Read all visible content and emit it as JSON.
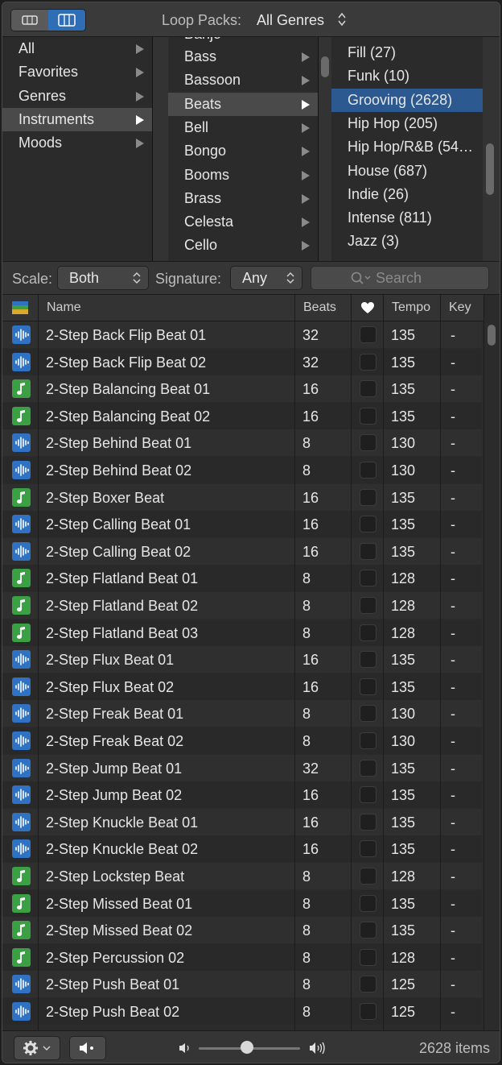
{
  "topbar": {
    "loop_packs_label": "Loop Packs:",
    "loop_packs_value": "All Genres"
  },
  "browser": {
    "column1": [
      {
        "label": "All"
      },
      {
        "label": "Favorites"
      },
      {
        "label": "Genres"
      },
      {
        "label": "Instruments",
        "selected": true
      },
      {
        "label": "Moods"
      }
    ],
    "column2_partial_top": "Banjo",
    "column2": [
      {
        "label": "Bass"
      },
      {
        "label": "Bassoon"
      },
      {
        "label": "Beats",
        "selected": true
      },
      {
        "label": "Bell"
      },
      {
        "label": "Bongo"
      },
      {
        "label": "Booms"
      },
      {
        "label": "Brass"
      },
      {
        "label": "Celesta"
      },
      {
        "label": "Cello"
      }
    ],
    "column3": [
      {
        "label": "Fill (27)"
      },
      {
        "label": "Funk (10)"
      },
      {
        "label": "Grooving (2628)",
        "selected": true
      },
      {
        "label": "Hip Hop (205)"
      },
      {
        "label": "Hip Hop/R&B (54…"
      },
      {
        "label": "House (687)"
      },
      {
        "label": "Indie (26)"
      },
      {
        "label": "Intense (811)"
      },
      {
        "label": "Jazz (3)"
      }
    ]
  },
  "filter": {
    "scale_label": "Scale:",
    "scale_value": "Both",
    "signature_label": "Signature:",
    "signature_value": "Any",
    "search_placeholder": "Search"
  },
  "table": {
    "columns": {
      "name": "Name",
      "beats": "Beats",
      "tempo": "Tempo",
      "key": "Key"
    },
    "rows": [
      {
        "type": "audio",
        "name": "2-Step Back Flip Beat 01",
        "beats": "32",
        "tempo": "135",
        "key": "-"
      },
      {
        "type": "audio",
        "name": "2-Step Back Flip Beat 02",
        "beats": "32",
        "tempo": "135",
        "key": "-"
      },
      {
        "type": "midi",
        "name": "2-Step Balancing Beat 01",
        "beats": "16",
        "tempo": "135",
        "key": "-"
      },
      {
        "type": "midi",
        "name": "2-Step Balancing Beat 02",
        "beats": "16",
        "tempo": "135",
        "key": "-"
      },
      {
        "type": "audio",
        "name": "2-Step Behind Beat 01",
        "beats": "8",
        "tempo": "130",
        "key": "-"
      },
      {
        "type": "audio",
        "name": "2-Step Behind Beat 02",
        "beats": "8",
        "tempo": "130",
        "key": "-"
      },
      {
        "type": "midi",
        "name": "2-Step Boxer Beat",
        "beats": "16",
        "tempo": "135",
        "key": "-"
      },
      {
        "type": "audio",
        "name": "2-Step Calling Beat 01",
        "beats": "16",
        "tempo": "135",
        "key": "-"
      },
      {
        "type": "audio",
        "name": "2-Step Calling Beat 02",
        "beats": "16",
        "tempo": "135",
        "key": "-"
      },
      {
        "type": "midi",
        "name": "2-Step Flatland Beat 01",
        "beats": "8",
        "tempo": "128",
        "key": "-"
      },
      {
        "type": "midi",
        "name": "2-Step Flatland Beat 02",
        "beats": "8",
        "tempo": "128",
        "key": "-"
      },
      {
        "type": "midi",
        "name": "2-Step Flatland Beat 03",
        "beats": "8",
        "tempo": "128",
        "key": "-"
      },
      {
        "type": "audio",
        "name": "2-Step Flux Beat 01",
        "beats": "16",
        "tempo": "135",
        "key": "-"
      },
      {
        "type": "audio",
        "name": "2-Step Flux Beat 02",
        "beats": "16",
        "tempo": "135",
        "key": "-"
      },
      {
        "type": "audio",
        "name": "2-Step Freak Beat 01",
        "beats": "8",
        "tempo": "130",
        "key": "-"
      },
      {
        "type": "audio",
        "name": "2-Step Freak Beat 02",
        "beats": "8",
        "tempo": "130",
        "key": "-"
      },
      {
        "type": "audio",
        "name": "2-Step Jump Beat 01",
        "beats": "32",
        "tempo": "135",
        "key": "-"
      },
      {
        "type": "audio",
        "name": "2-Step Jump Beat 02",
        "beats": "16",
        "tempo": "135",
        "key": "-"
      },
      {
        "type": "audio",
        "name": "2-Step Knuckle Beat 01",
        "beats": "16",
        "tempo": "135",
        "key": "-"
      },
      {
        "type": "audio",
        "name": "2-Step Knuckle Beat 02",
        "beats": "16",
        "tempo": "135",
        "key": "-"
      },
      {
        "type": "midi",
        "name": "2-Step Lockstep Beat",
        "beats": "8",
        "tempo": "128",
        "key": "-"
      },
      {
        "type": "midi",
        "name": "2-Step Missed Beat 01",
        "beats": "8",
        "tempo": "135",
        "key": "-"
      },
      {
        "type": "midi",
        "name": "2-Step Missed Beat 02",
        "beats": "8",
        "tempo": "135",
        "key": "-"
      },
      {
        "type": "midi",
        "name": "2-Step Percussion 02",
        "beats": "8",
        "tempo": "128",
        "key": "-"
      },
      {
        "type": "audio",
        "name": "2-Step Push Beat 01",
        "beats": "8",
        "tempo": "125",
        "key": "-"
      },
      {
        "type": "audio",
        "name": "2-Step Push Beat 02",
        "beats": "8",
        "tempo": "125",
        "key": "-"
      }
    ]
  },
  "bottom": {
    "item_count": "2628 items",
    "volume_level": 0.48
  },
  "colors": {
    "selection_blue": "#2c5a90",
    "audio_icon": "#2f72c4",
    "midi_icon": "#3aa043"
  }
}
